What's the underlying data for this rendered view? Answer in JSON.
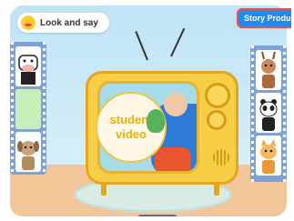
{
  "header": {
    "title": "Look and say"
  },
  "story_button": {
    "label": "Story Produc"
  },
  "screen": {
    "student_video_label": "student video"
  },
  "left_strip": {
    "items": [
      "cow-icon",
      "empty-slot",
      "dog-icon"
    ]
  },
  "right_strip": {
    "items": [
      "reindeer-icon",
      "panda-icon",
      "cat-icon"
    ]
  },
  "colors": {
    "accent": "#1f8bf0",
    "tv_body": "#f6cf46",
    "story_border": "#ff4a3a"
  }
}
